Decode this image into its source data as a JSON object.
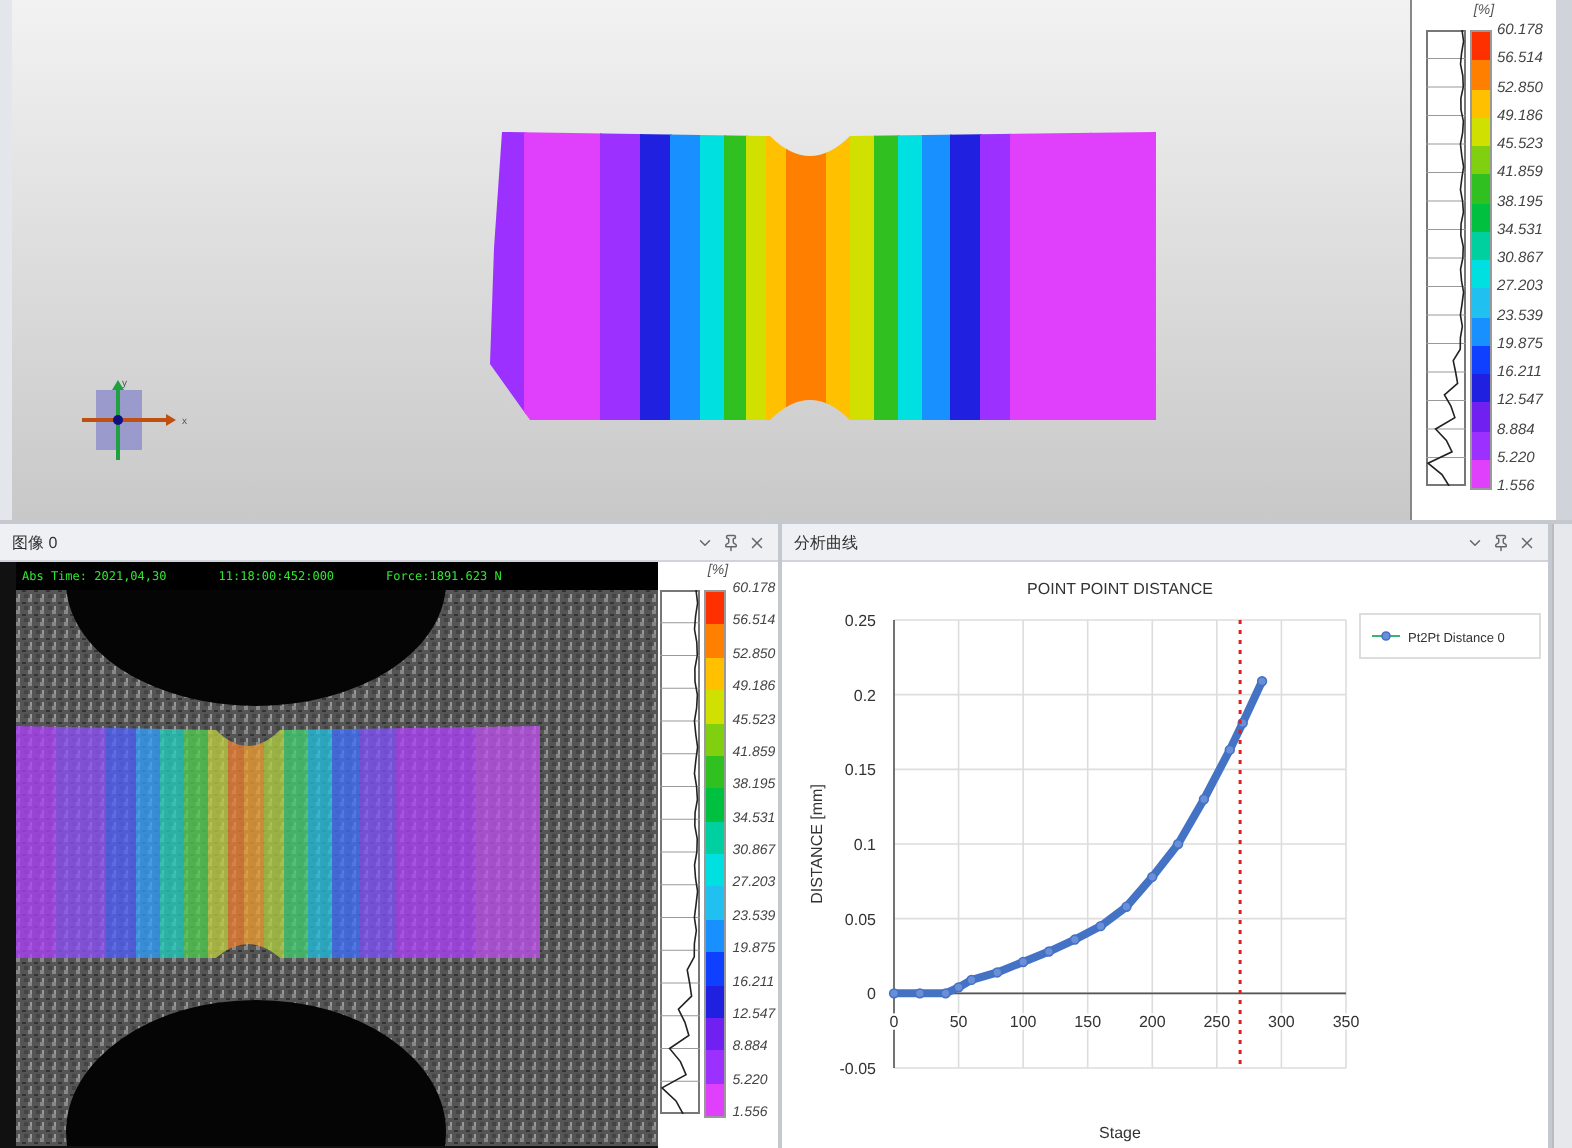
{
  "viewport": {
    "gizmo": {
      "x_label": "x",
      "y_label": "y"
    }
  },
  "top_legend": {
    "unit": "[%]",
    "labels": [
      "60.178",
      "56.514",
      "52.850",
      "49.186",
      "45.523",
      "41.859",
      "38.195",
      "34.531",
      "30.867",
      "27.203",
      "23.539",
      "19.875",
      "16.211",
      "12.547",
      "8.884",
      "5.220",
      "1.556"
    ]
  },
  "image_panel": {
    "title": "图像 0",
    "overlay": {
      "time_label": "Abs Time: 2021,04,30",
      "clock": "11:18:00:452:000",
      "force": "Force:1891.623 N"
    },
    "legend": {
      "unit": "[%]",
      "labels": [
        "60.178",
        "56.514",
        "52.850",
        "49.186",
        "45.523",
        "41.859",
        "38.195",
        "34.531",
        "30.867",
        "27.203",
        "23.539",
        "19.875",
        "16.211",
        "12.547",
        "8.884",
        "5.220",
        "1.556"
      ]
    }
  },
  "chart_panel": {
    "title": "分析曲线",
    "chart_data": {
      "type": "line",
      "title": "POINT POINT DISTANCE",
      "xlabel": "Stage",
      "ylabel": "DISTANCE [mm]",
      "x": [
        0,
        20,
        40,
        50,
        60,
        80,
        100,
        120,
        140,
        160,
        180,
        200,
        220,
        240,
        260,
        270,
        285
      ],
      "grid": true,
      "series": [
        {
          "name": "Pt2Pt Distance 0",
          "color": "#4472c4",
          "marker": "o",
          "values": [
            0,
            0,
            0,
            0.004,
            0.009,
            0.014,
            0.021,
            0.028,
            0.036,
            0.045,
            0.058,
            0.078,
            0.1,
            0.13,
            0.163,
            0.181,
            0.209
          ]
        }
      ],
      "xlim": [
        0,
        350
      ],
      "ylim": [
        -0.05,
        0.25
      ],
      "xticks": [
        0,
        50,
        100,
        150,
        200,
        250,
        300,
        350
      ],
      "yticks": [
        -0.05,
        0,
        0.05,
        0.1,
        0.15,
        0.2,
        0.25
      ],
      "ref_lines": [
        {
          "axis": "x",
          "value": 268,
          "color": "#e02020"
        }
      ]
    }
  }
}
